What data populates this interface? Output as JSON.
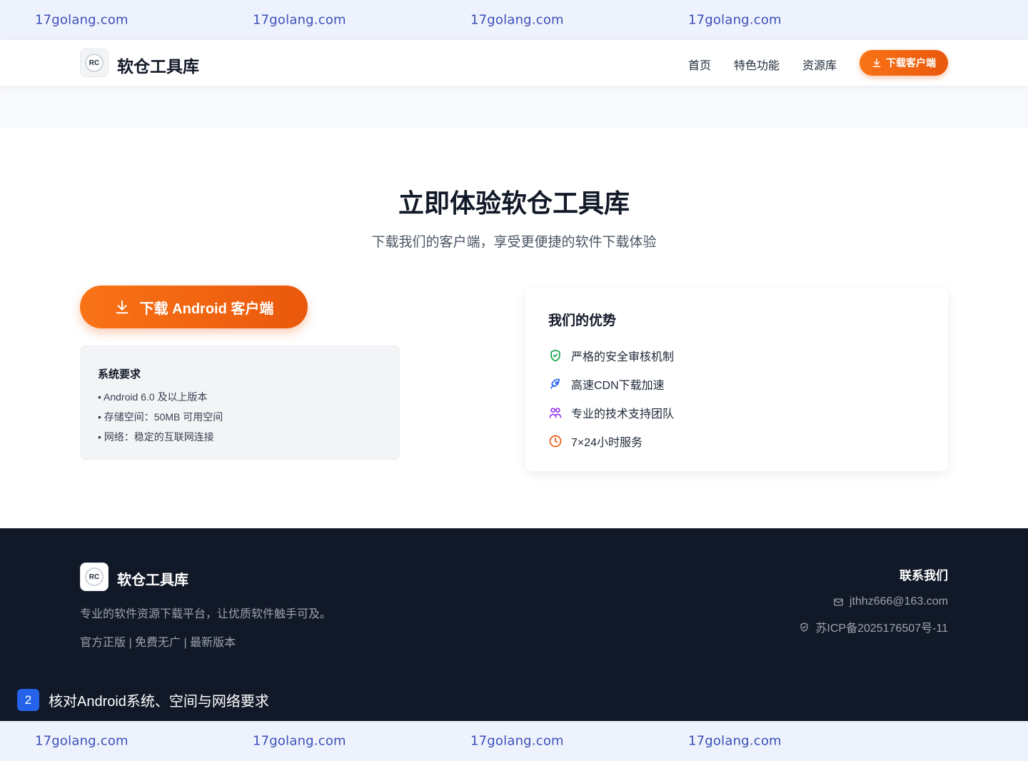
{
  "watermark": {
    "top": [
      "17golang.com",
      "17golang.com",
      "17golang.com",
      "17golang.com"
    ],
    "bottom": [
      "17golang.com",
      "17golang.com",
      "17golang.com",
      "17golang.com"
    ]
  },
  "header": {
    "logo_text": "RC",
    "brand": "软仓工具库",
    "nav": [
      "首页",
      "特色功能",
      "资源库"
    ],
    "download_label": "下载客户端"
  },
  "hero": {
    "title": "立即体验软仓工具库",
    "subtitle": "下载我们的客户端，享受更便捷的软件下载体验",
    "android_button": "下载 Android 客户端"
  },
  "requirements": {
    "title": "系统要求",
    "items": [
      "• Android 6.0 及以上版本",
      "• 存储空间：50MB 可用空间",
      "• 网络：稳定的互联网连接"
    ]
  },
  "advantages": {
    "title": "我们的优势",
    "items": [
      {
        "label": "严格的安全审核机制",
        "icon": "shield-check-icon",
        "color": "#16a34a"
      },
      {
        "label": "高速CDN下载加速",
        "icon": "rocket-icon",
        "color": "#2563eb"
      },
      {
        "label": "专业的技术支持团队",
        "icon": "users-icon",
        "color": "#9333ea"
      },
      {
        "label": "7×24小时服务",
        "icon": "clock-icon",
        "color": "#ea580c"
      }
    ]
  },
  "footer": {
    "brand": "软仓工具库",
    "description": "专业的软件资源下载平台，让优质软件触手可及。",
    "tags": "官方正版 | 免费无广 | 最新版本",
    "contact_title": "联系我们",
    "email": "jthhz666@163.com",
    "icp": "苏ICP备2025176507号-11"
  },
  "step": {
    "number": "2",
    "text": "核对Android系统、空间与网络要求"
  },
  "colors": {
    "accent": "#f97316",
    "footer_bg": "#111827",
    "watermark_bg": "#eef2fd"
  }
}
